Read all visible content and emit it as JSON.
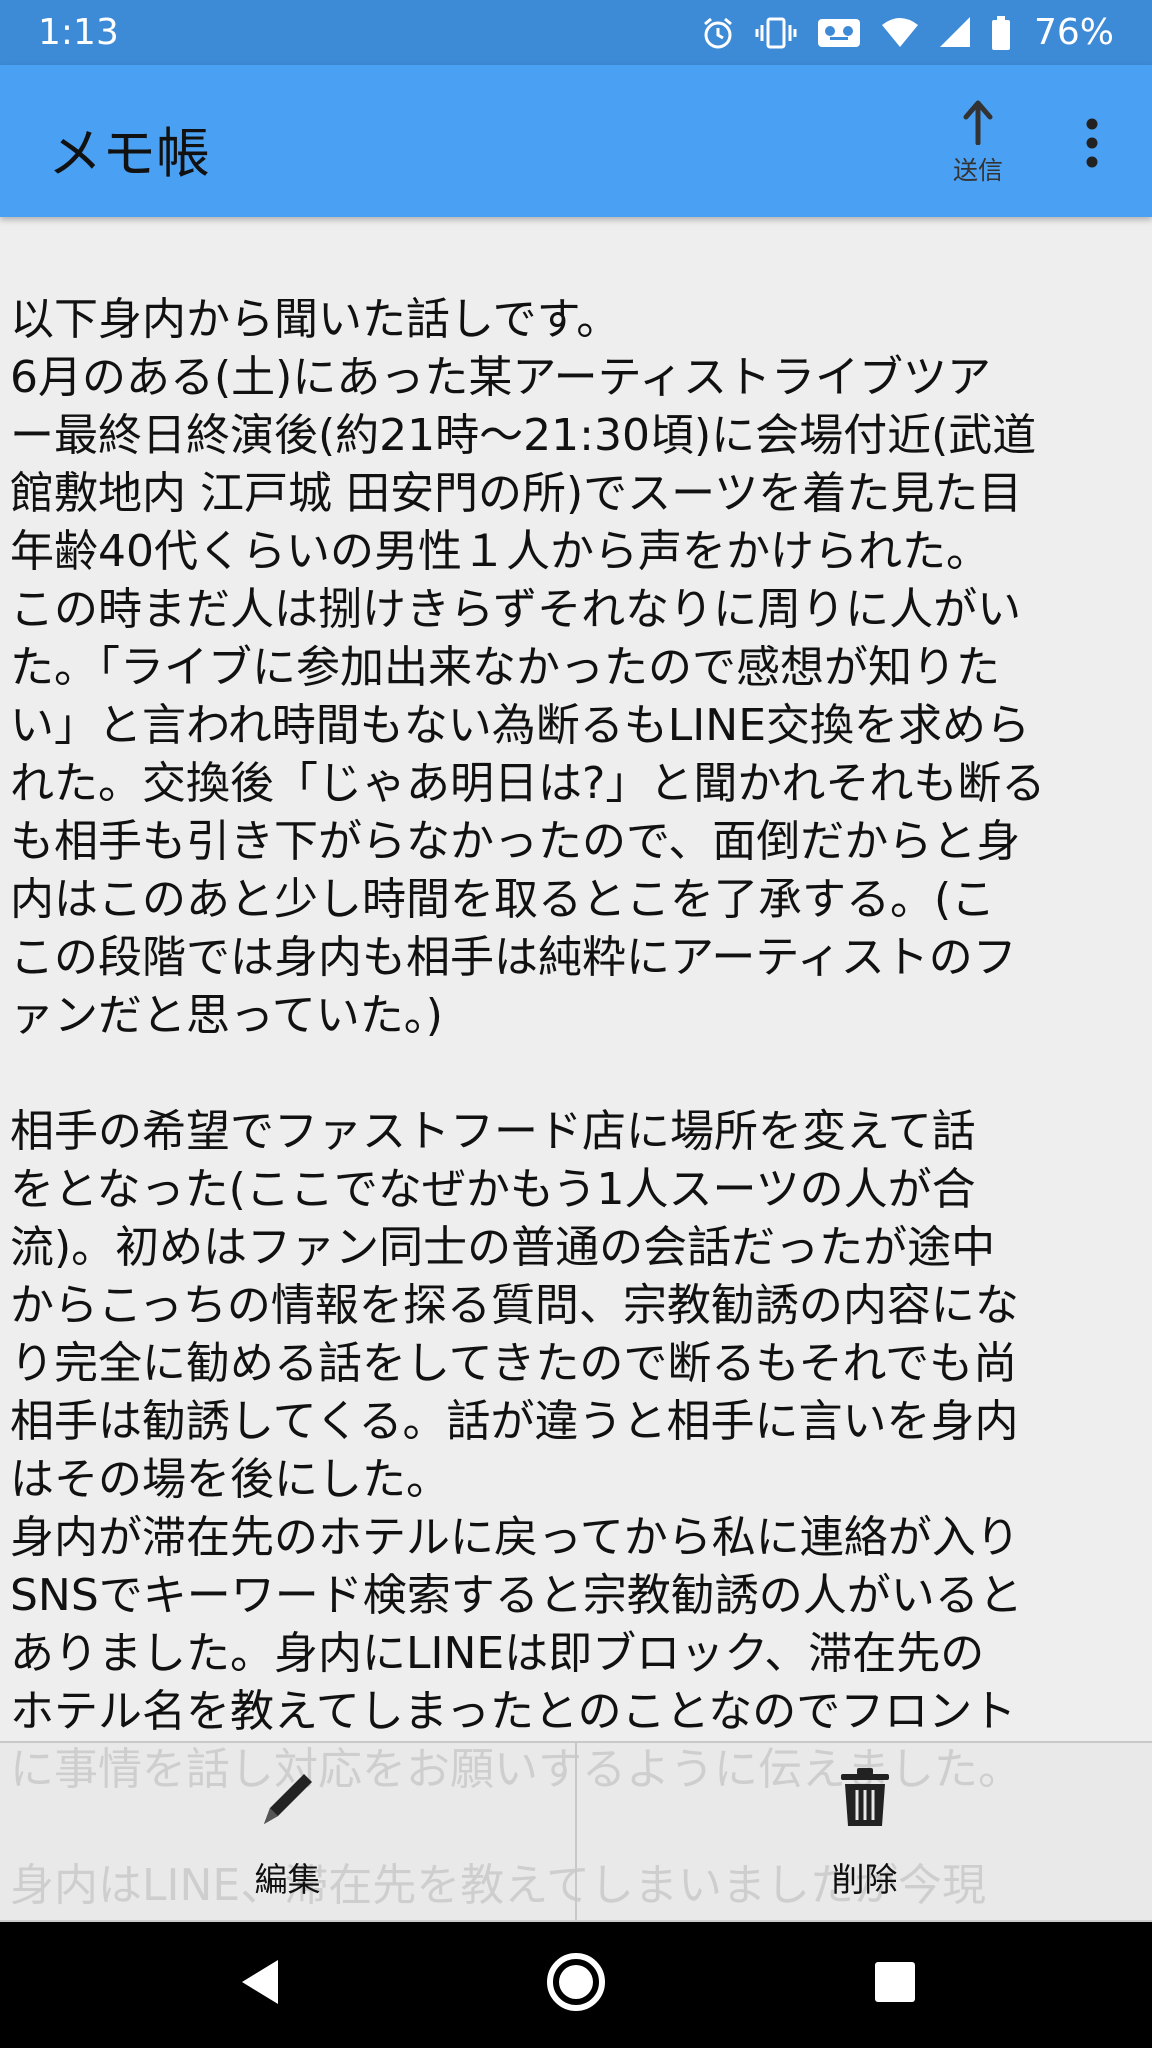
{
  "status_bar": {
    "time": "1:13",
    "battery_percent": "76%",
    "icons": [
      "alarm-icon",
      "vibrate-icon",
      "voicemail-icon",
      "wifi-icon",
      "cell-signal-icon",
      "battery-icon"
    ]
  },
  "app_bar": {
    "title": "メモ帳",
    "send_label": "送信",
    "send_icon": "arrow-up-icon",
    "more_icon": "more-vert-icon"
  },
  "memo": {
    "text": "以下身内から聞いた話しです。\n6月のある(土)にあった某アーティストライブツア\nー最終日終演後(約21時〜21:30頃)に会場付近(武道\n館敷地内 江戸城 田安門の所)でスーツを着た見た目\n年齢40代くらいの男性１人から声をかけられた。\nこの時まだ人は捌けきらずそれなりに周りに人がい\nた。「ライブに参加出来なかったので感想が知りた\nい」と言われ時間もない為断るもLINE交換を求めら\nれた。交換後「じゃあ明日は?」と聞かれそれも断る\nも相手も引き下がらなかったので、面倒だからと身\n内はこのあと少し時間を取るとこを了承する。(こ\nこの段階では身内も相手は純粋にアーティストのフ\nァンだと思っていた。)\n\n相手の希望でファストフード店に場所を変えて話\nをとなった(ここでなぜかもう1人スーツの人が合\n流)。初めはファン同士の普通の会話だったが途中\nからこっちの情報を探る質問、宗教勧誘の内容にな\nり完全に勧める話をしてきたので断るもそれでも尚\n相手は勧誘してくる。話が違うと相手に言いを身内\nはその場を後にした。\n身内が滞在先のホテルに戻ってから私に連絡が入り\nSNSでキーワード検索すると宗教勧誘の人がいると\nありました。身内にLINEは即ブロック、滞在先の\nホテル名を教えてしまったとのことなのでフロント\nに事情を話し対応をお願いするように伝えました。\n\n身内はLINE、滞在先を教えてしまいましたが今現"
  },
  "actions": {
    "edit_label": "編集",
    "edit_icon": "pencil-icon",
    "delete_label": "削除",
    "delete_icon": "trash-icon"
  },
  "nav_bar": {
    "back_icon": "back-triangle-icon",
    "home_icon": "home-circle-icon",
    "recents_icon": "recents-square-icon"
  },
  "colors": {
    "status_bar": "#3d8ad6",
    "app_bar": "#4aa1f3",
    "background": "#eeeeee",
    "nav_bar": "#000000"
  }
}
